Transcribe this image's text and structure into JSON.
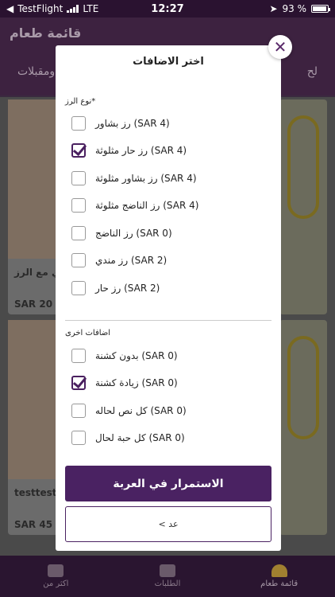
{
  "status": {
    "carrier": "TestFlight",
    "network": "LTE",
    "time": "12:27",
    "battery": "93 %"
  },
  "background": {
    "header_title": "قائمة طعام",
    "tab_right": "لح",
    "tab_left": "ومقبلات",
    "card1_name": "ي مع الرز",
    "card1_price": "SAR 20",
    "card2_name": "testtest",
    "card2_price": "SAR 45",
    "tabbar": {
      "menu": "قائمة طعام",
      "orders": "الطلبات",
      "more": "اكثر من"
    }
  },
  "modal": {
    "title": "اختر الاضافات",
    "close_icon": "close-icon",
    "groups": [
      {
        "title": "نوع الرز*",
        "options": [
          {
            "label": "رز بشاور (SAR 4)",
            "checked": false
          },
          {
            "label": "رز حار مثلوثة (SAR 4)",
            "checked": true
          },
          {
            "label": "رز بشاور مثلوثة (SAR 4)",
            "checked": false
          },
          {
            "label": "رز الناضج مثلوثة (SAR 4)",
            "checked": false
          },
          {
            "label": "رز الناضج (SAR 0)",
            "checked": false
          },
          {
            "label": "رز مندي (SAR 2)",
            "checked": false
          },
          {
            "label": "رز حار (SAR 2)",
            "checked": false
          }
        ]
      },
      {
        "title": "اضافات اخرى",
        "options": [
          {
            "label": "بدون كشنة (SAR 0)",
            "checked": false
          },
          {
            "label": "زيادة كشنة (SAR 0)",
            "checked": true
          },
          {
            "label": "كل نص لحاله (SAR 0)",
            "checked": false
          },
          {
            "label": "كل حبة لحال (SAR 0)",
            "checked": false
          }
        ]
      }
    ],
    "continue_label": "الاستمرار في العربة",
    "back_label": "< عد"
  }
}
